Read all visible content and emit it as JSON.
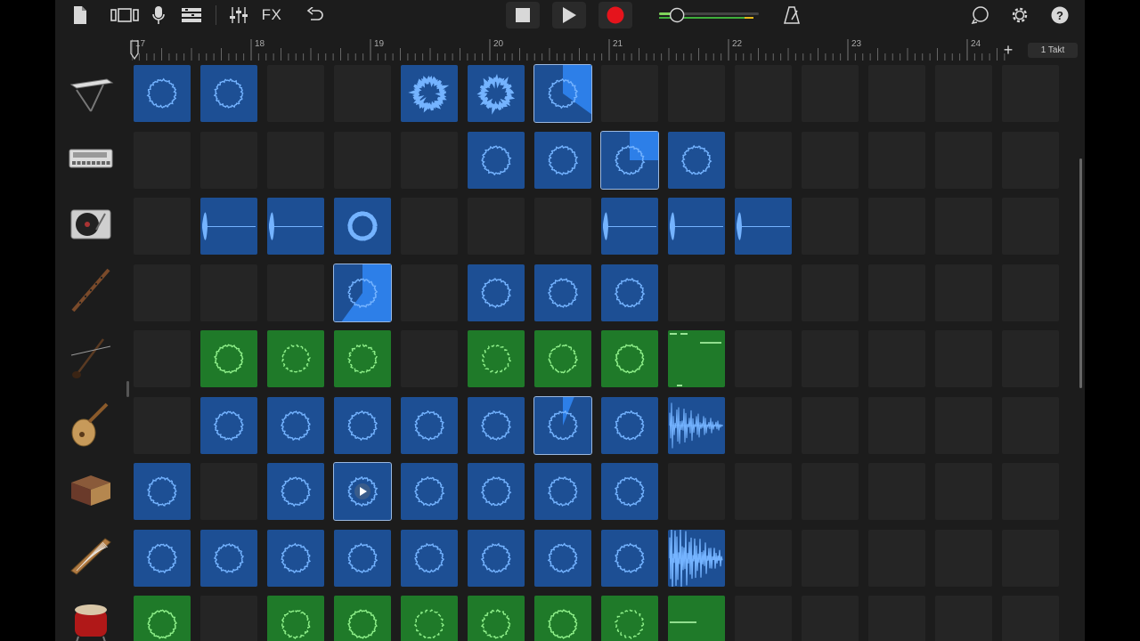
{
  "toolbar": {
    "fx_label": "FX",
    "left_icons": [
      "document-icon",
      "view-toggle-icon",
      "microphone-icon",
      "tracks-list-icon",
      "mixer-icon"
    ],
    "transport": [
      "stop-icon",
      "play-icon",
      "record-icon"
    ],
    "master_volume": 0.18,
    "colors": {
      "record": "#e5141c",
      "volume_fill": "#7fd35b",
      "accent": "#d8d8d8"
    }
  },
  "ruler": {
    "bars": [
      "17",
      "18",
      "19",
      "20",
      "21",
      "22",
      "23",
      "24"
    ],
    "add_label": "+",
    "section_label": "1 Takt"
  },
  "tracks": [
    {
      "instrument": "keyboard-icon"
    },
    {
      "instrument": "drum-machine-icon"
    },
    {
      "instrument": "turntable-icon"
    },
    {
      "instrument": "flute-icon"
    },
    {
      "instrument": "erhu-icon"
    },
    {
      "instrument": "pipa-icon"
    },
    {
      "instrument": "percussion-box-icon"
    },
    {
      "instrument": "guzheng-icon"
    },
    {
      "instrument": "taiko-drum-icon"
    }
  ],
  "cells": [
    [
      "b",
      "b",
      "",
      "",
      "bs",
      "bs",
      "b:0.35",
      "",
      "",
      "",
      "",
      "",
      "",
      ""
    ],
    [
      "",
      "",
      "",
      "",
      "",
      "b",
      "b",
      "b:0.25",
      "b",
      "",
      "",
      "",
      "",
      ""
    ],
    [
      "",
      "bw",
      "bw",
      "bt",
      "",
      "",
      "",
      "bw",
      "bw",
      "bw",
      "",
      "",
      "",
      ""
    ],
    [
      "",
      "",
      "",
      "b:0.6",
      "",
      "b",
      "b",
      "b",
      "",
      "",
      "",
      "",
      "",
      ""
    ],
    [
      "",
      "g",
      "g",
      "g",
      "",
      "g",
      "g",
      "g",
      "gm",
      "",
      "",
      "",
      "",
      ""
    ],
    [
      "",
      "b",
      "b",
      "b",
      "b",
      "b",
      "b:0.06",
      "b",
      "bw2",
      "",
      "",
      "",
      "",
      ""
    ],
    [
      "b",
      "",
      "b",
      "bp",
      "b",
      "b",
      "b",
      "b",
      "",
      "",
      "",
      "",
      "",
      ""
    ],
    [
      "b",
      "b",
      "b",
      "b",
      "b",
      "b",
      "b",
      "b",
      "bw3",
      "",
      "",
      "",
      "",
      ""
    ],
    [
      "g",
      "",
      "g",
      "g",
      "g",
      "g",
      "g",
      "g",
      "gm2",
      "",
      "",
      "",
      "",
      ""
    ]
  ]
}
